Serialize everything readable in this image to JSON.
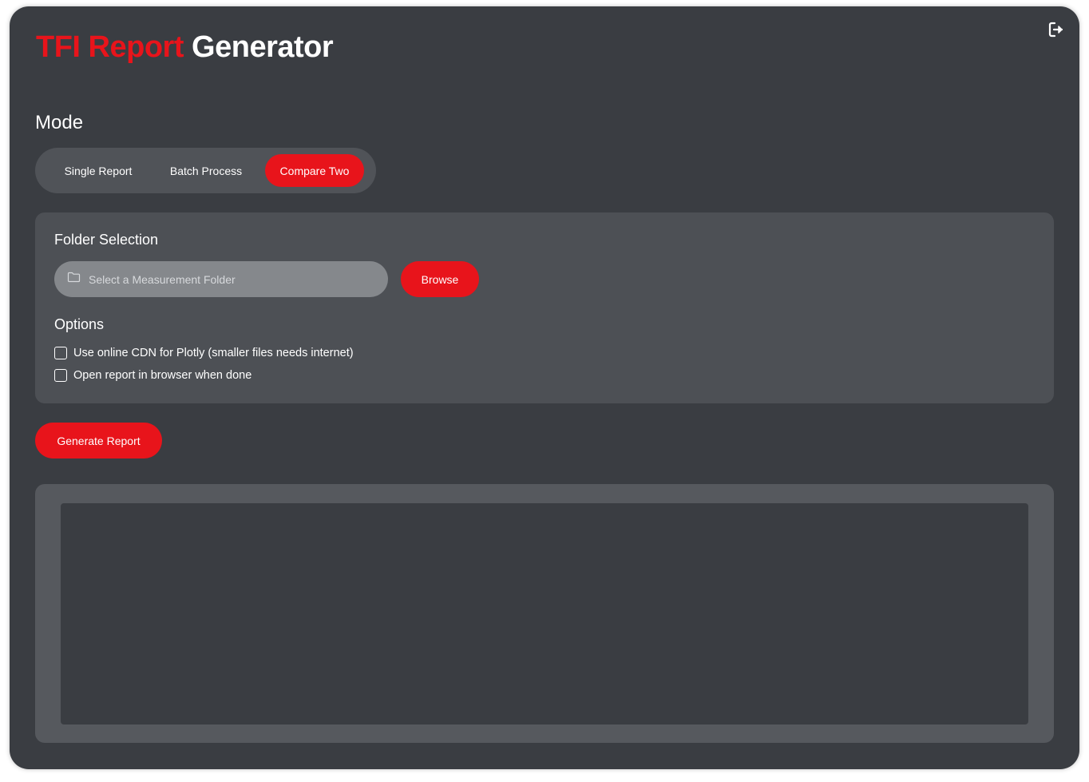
{
  "header": {
    "title_accent": "TFI Report",
    "title_rest": "Generator",
    "logout_icon": "logout-icon"
  },
  "mode": {
    "heading": "Mode",
    "options": [
      {
        "label": "Single Report",
        "active": false
      },
      {
        "label": "Batch Process",
        "active": false
      },
      {
        "label": "Compare Two",
        "active": true
      }
    ]
  },
  "folder_selection": {
    "heading": "Folder Selection",
    "input_placeholder": "Select a Measurement Folder",
    "input_value": "",
    "input_icon": "folder-icon",
    "browse_label": "Browse"
  },
  "options": {
    "heading": "Options",
    "items": [
      {
        "label": "Use online CDN for Plotly (smaller files needs internet)",
        "checked": false
      },
      {
        "label": "Open report in browser when done",
        "checked": false
      }
    ]
  },
  "actions": {
    "generate_label": "Generate Report"
  },
  "colors": {
    "accent": "#e8141b",
    "background": "#3a3d42",
    "panel": "#4d5055"
  }
}
